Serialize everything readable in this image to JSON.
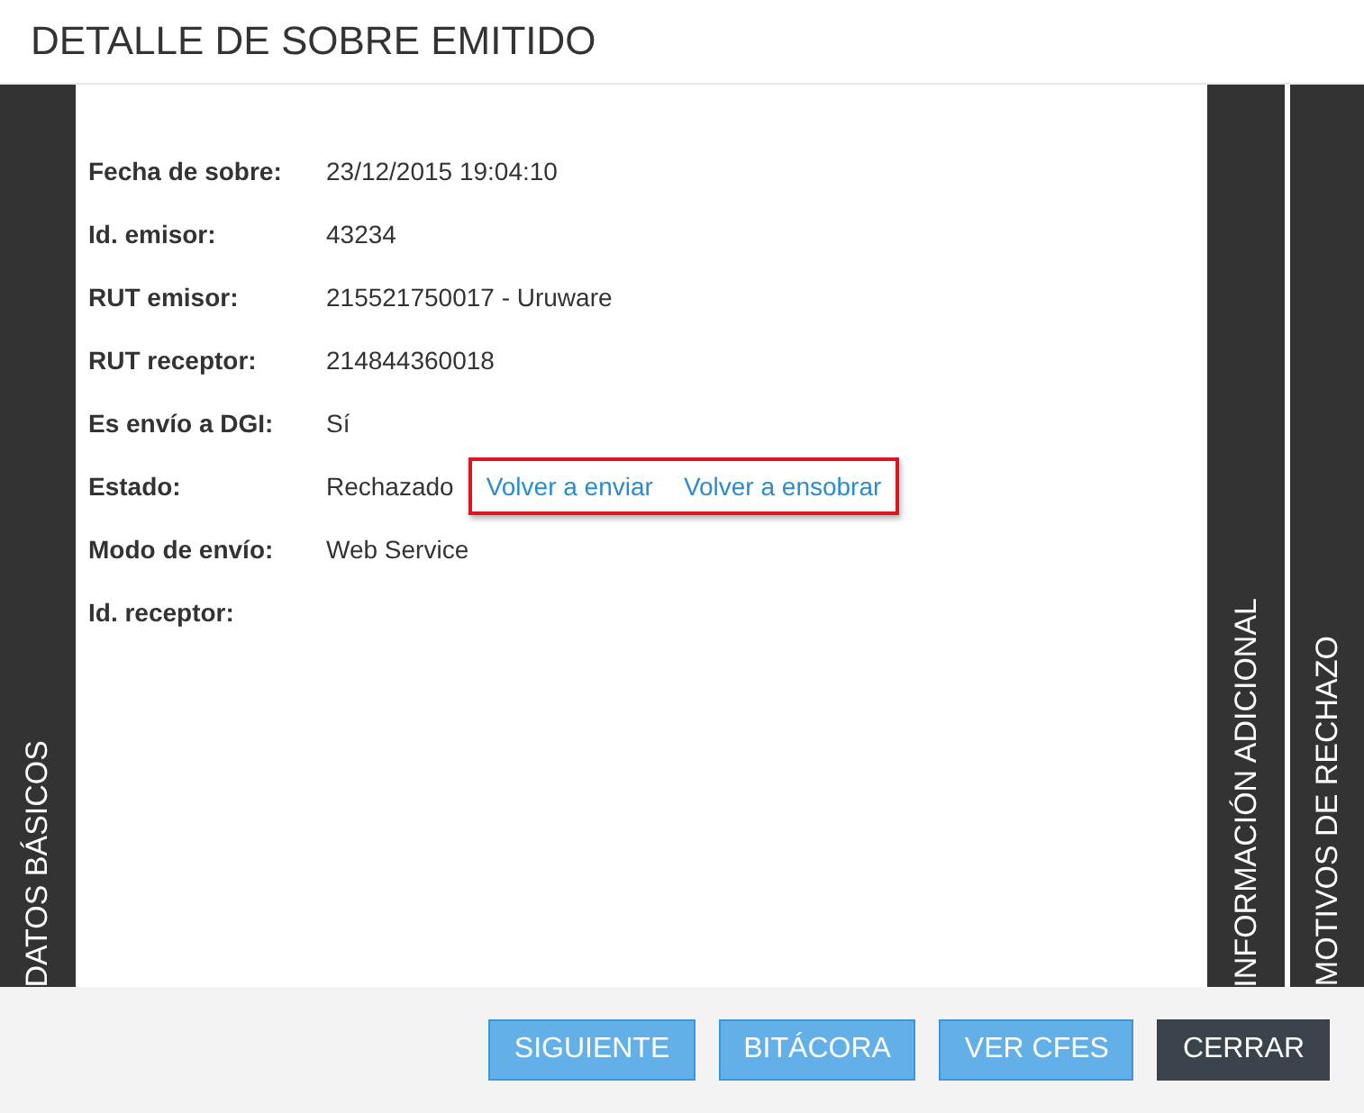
{
  "window": {
    "title": "DETALLE DE SOBRE EMITIDO"
  },
  "left_tabs": [
    {
      "label": "DATOS BÁSICOS"
    }
  ],
  "right_tabs": [
    {
      "label": "INFORMACIÓN ADICIONAL"
    },
    {
      "label": "MOTIVOS DE RECHAZO"
    }
  ],
  "fields": [
    {
      "label": "Fecha de sobre:",
      "value": "23/12/2015 19:04:10"
    },
    {
      "label": "Id. emisor:",
      "value": "43234"
    },
    {
      "label": "RUT emisor:",
      "value": "215521750017 - Uruware"
    },
    {
      "label": "RUT receptor:",
      "value": "214844360018"
    },
    {
      "label": "Es envío a DGI:",
      "value": "Sí"
    },
    {
      "label": "Estado:",
      "value": "Rechazado",
      "links": [
        "Volver a enviar",
        "Volver a ensobrar"
      ],
      "highlighted": true
    },
    {
      "label": "Modo de envío:",
      "value": "Web Service"
    },
    {
      "label": "Id. receptor:"
    }
  ],
  "buttons": [
    {
      "label": "SIGUIENTE",
      "kind": "primary"
    },
    {
      "label": "BITÁCORA",
      "kind": "primary"
    },
    {
      "label": "VER CFES",
      "kind": "primary"
    },
    {
      "label": "CERRAR",
      "kind": "dark"
    }
  ]
}
